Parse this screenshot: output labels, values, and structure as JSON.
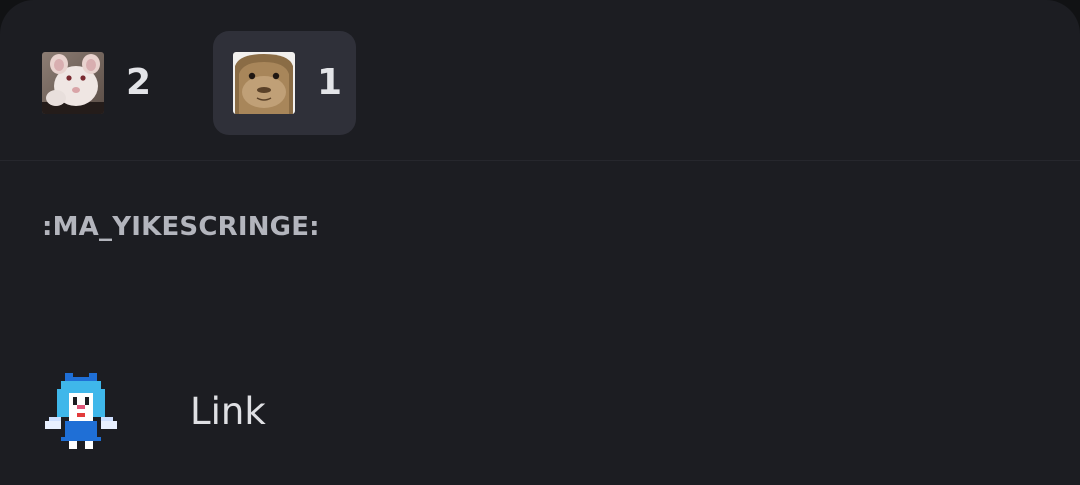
{
  "reactions": [
    {
      "emoji": "rat-emoji",
      "count": "2",
      "selected": false
    },
    {
      "emoji": "capybara-emoji",
      "count": "1",
      "selected": true
    }
  ],
  "selected_emoji_name": ":MA_YIKESCRINGE:",
  "reactors": [
    {
      "avatar": "pixel-fairy-avatar",
      "username": "Link"
    }
  ],
  "colors": {
    "sheet_background": "#1c1d22",
    "selected_reaction_background": "#2f3039",
    "count_text": "#e3e4e8",
    "emoji_name_text": "#b3b5bd"
  }
}
